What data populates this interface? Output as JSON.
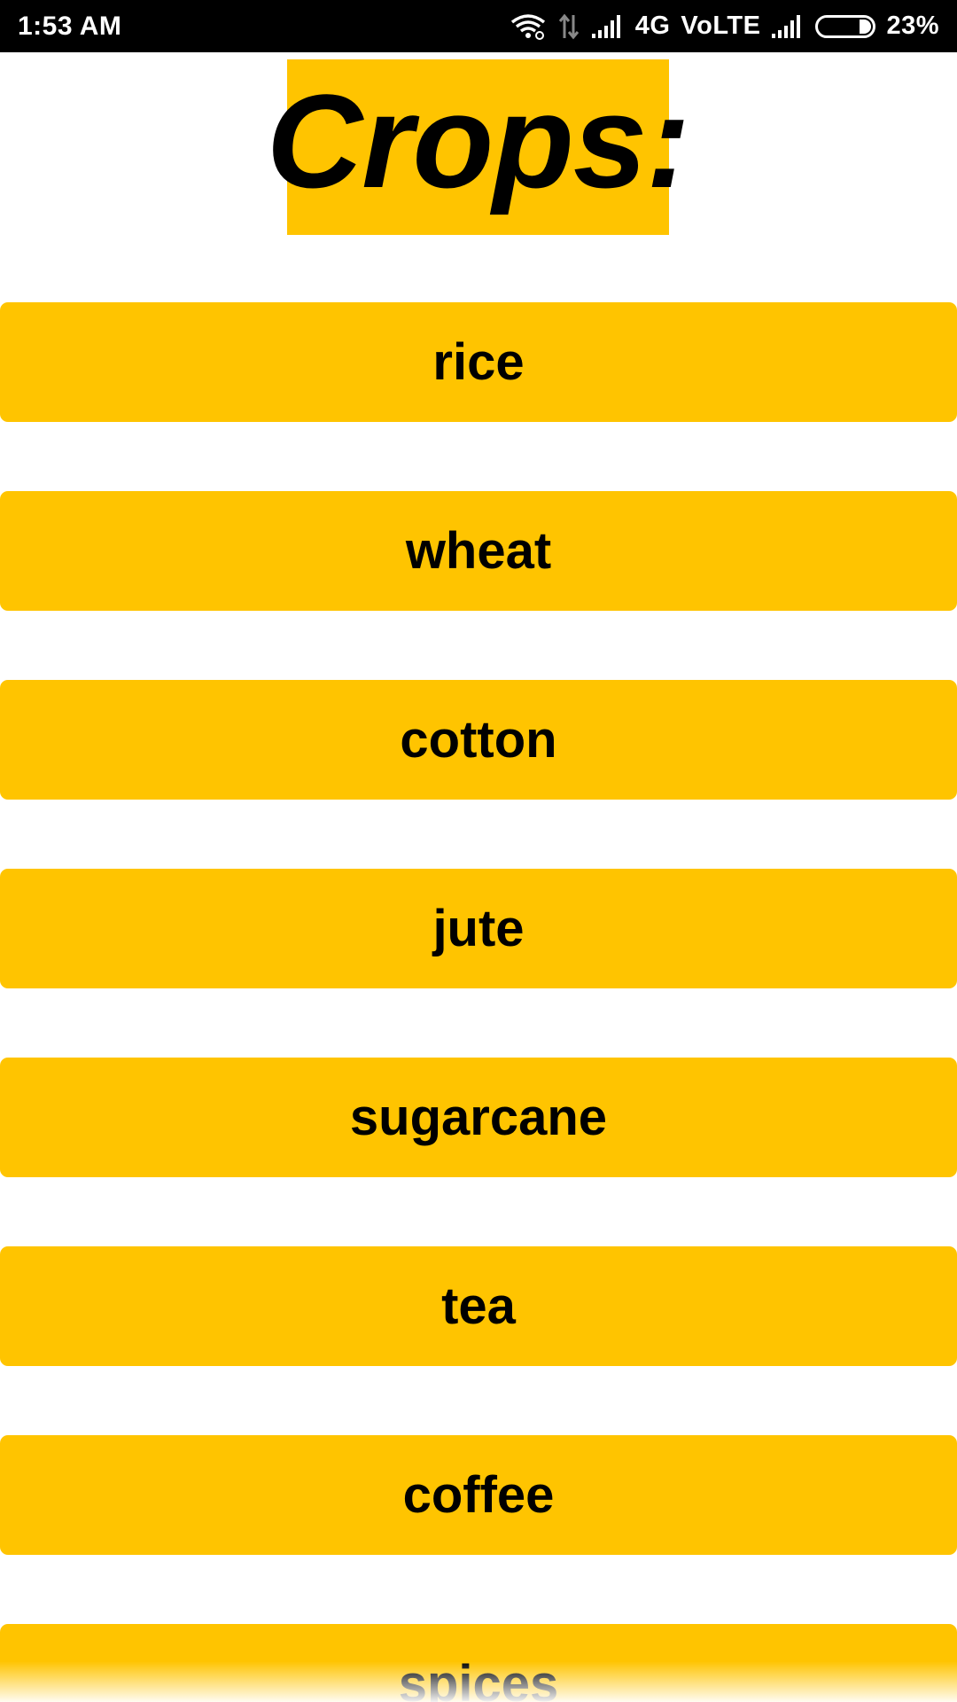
{
  "status_bar": {
    "time": "1:53 AM",
    "network": "4G",
    "volte": "VoLTE",
    "battery": "23%",
    "battery_level": 0.23,
    "icons": [
      "wifi-icon",
      "data-transfer-icon",
      "signal-icon",
      "signal-icon",
      "battery-icon"
    ]
  },
  "title": "Crops:",
  "colors": {
    "accent": "#FFC400",
    "text": "#000000",
    "background": "#FFFFFF",
    "status_bar": "#000000"
  },
  "crops": [
    {
      "label": "rice"
    },
    {
      "label": "wheat"
    },
    {
      "label": "cotton"
    },
    {
      "label": "jute"
    },
    {
      "label": "sugarcane"
    },
    {
      "label": "tea"
    },
    {
      "label": "coffee"
    },
    {
      "label": "spices"
    }
  ]
}
